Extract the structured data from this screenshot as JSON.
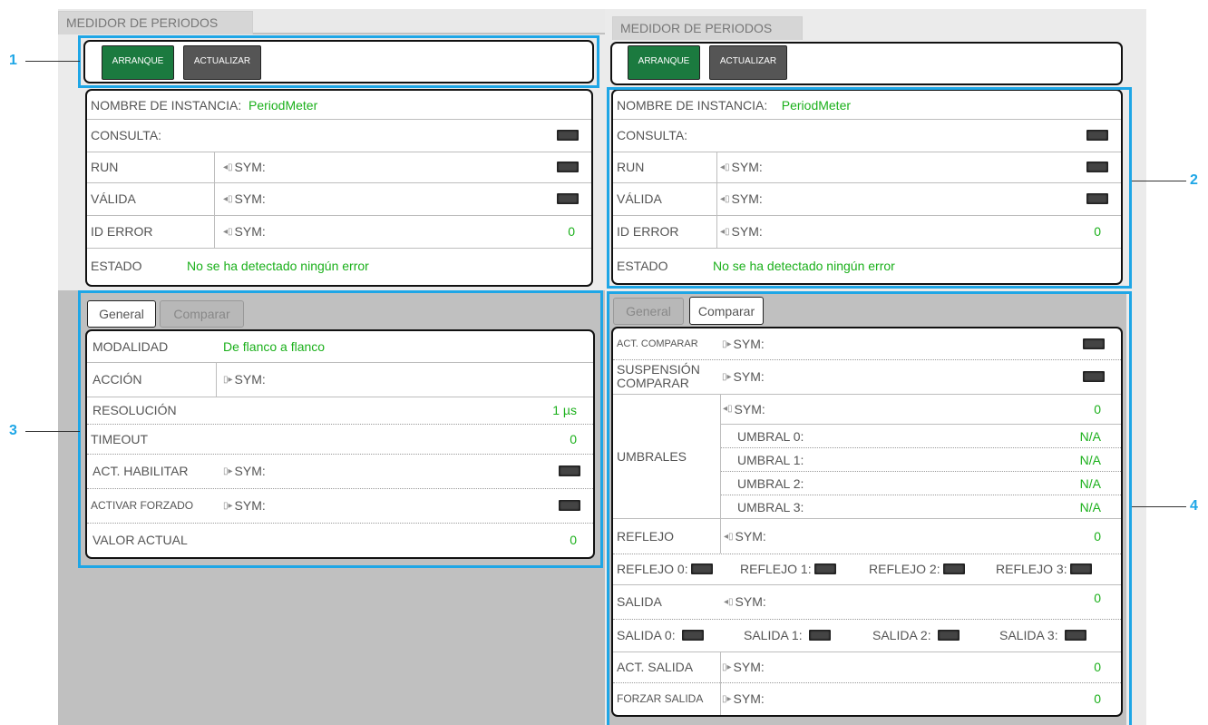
{
  "title": "MEDIDOR DE PERIODOS",
  "buttons": {
    "start": "ARRANQUE",
    "update": "ACTUALIZAR"
  },
  "callouts": {
    "c1": "1",
    "c2": "2",
    "c3": "3",
    "c4": "4"
  },
  "colors": {
    "highlight": "#1ea6e6",
    "value_green": "#1bb01b",
    "button_green": "#1b7a3f"
  },
  "info": {
    "instance_label": "NOMBRE DE INSTANCIA:",
    "instance_value": "PeriodMeter",
    "query_label": "CONSULTA:",
    "run_label": "RUN",
    "valid_label": "VÁLIDA",
    "error_id_label": "ID ERROR",
    "error_id_value": "0",
    "state_label": "ESTADO",
    "state_value": "No se ha detectado ningún error",
    "sym": "SYM:"
  },
  "tabs": {
    "general": "General",
    "compare": "Comparar"
  },
  "general": {
    "mode_label": "MODALIDAD",
    "mode_value": "De flanco a flanco",
    "action_label": "ACCIÓN",
    "resolution_label": "RESOLUCIÓN",
    "resolution_value": "1 µs",
    "timeout_label": "TIMEOUT",
    "timeout_value": "0",
    "enable_label": "ACT. HABILITAR",
    "force_label": "ACTIVAR FORZADO",
    "current_label": "VALOR ACTUAL",
    "current_value": "0"
  },
  "compare": {
    "act_compare": "ACT. COMPARAR",
    "suspend_compare": "SUSPENSIÓN COMPARAR",
    "thresholds_label": "UMBRALES",
    "thresholds_sym_value": "0",
    "thresholds": [
      {
        "label": "UMBRAL 0:",
        "value": "N/A"
      },
      {
        "label": "UMBRAL 1:",
        "value": "N/A"
      },
      {
        "label": "UMBRAL 2:",
        "value": "N/A"
      },
      {
        "label": "UMBRAL 3:",
        "value": "N/A"
      }
    ],
    "reflex_label": "REFLEJO",
    "reflex_value": "0",
    "reflex_items": [
      "REFLEJO 0:",
      "REFLEJO 1:",
      "REFLEJO 2:",
      "REFLEJO 3:"
    ],
    "output_label": "SALIDA",
    "output_value": "0",
    "output_items": [
      "SALIDA 0:",
      "SALIDA 1:",
      "SALIDA 2:",
      "SALIDA 3:"
    ],
    "act_output_label": "ACT. SALIDA",
    "act_output_value": "0",
    "force_output_label": "FORZAR SALIDA",
    "force_output_value": "0"
  }
}
